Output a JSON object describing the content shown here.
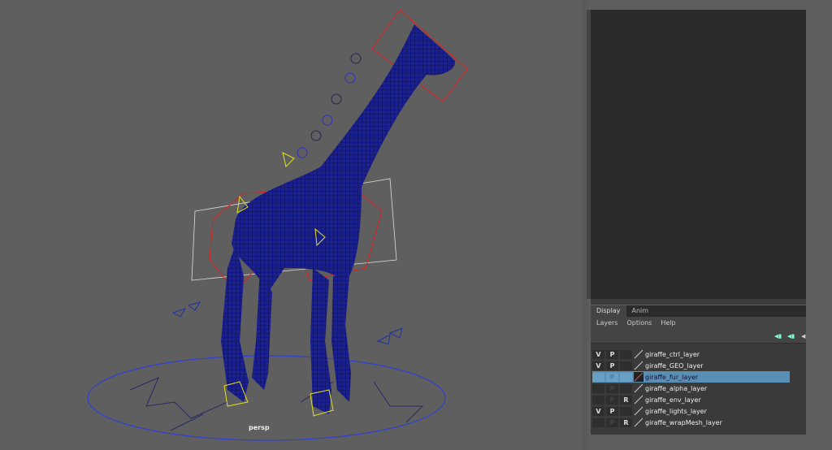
{
  "viewport": {
    "camera_label": "persp"
  },
  "layer_editor": {
    "tabs": [
      {
        "label": "Display",
        "active": true
      },
      {
        "label": "Anim",
        "active": false
      }
    ],
    "menu": [
      "Layers",
      "Options",
      "Help"
    ],
    "layers": [
      {
        "v": "V",
        "p": "P",
        "r": "",
        "name": "giraffe_ctrl_layer",
        "selected": false
      },
      {
        "v": "V",
        "p": "P",
        "r": "",
        "name": "giraffe_GEO_layer",
        "selected": false
      },
      {
        "v": "",
        "p": "P",
        "r": "",
        "name": "giraffe_fur_layer",
        "selected": true
      },
      {
        "v": "",
        "p": "P",
        "r": "",
        "name": "giraffe_alpha_layer",
        "selected": false
      },
      {
        "v": "",
        "p": "P",
        "r": "R",
        "name": "giraffe_env_layer",
        "selected": false
      },
      {
        "v": "V",
        "p": "P",
        "r": "",
        "name": "giraffe_lights_layer",
        "selected": false
      },
      {
        "v": "",
        "p": "P",
        "r": "R",
        "name": "giraffe_wrapMesh_layer",
        "selected": false
      }
    ]
  },
  "colors": {
    "selection": "#5a8fb5",
    "mesh": "#1a1f8a",
    "ctrl": "#e02020"
  }
}
